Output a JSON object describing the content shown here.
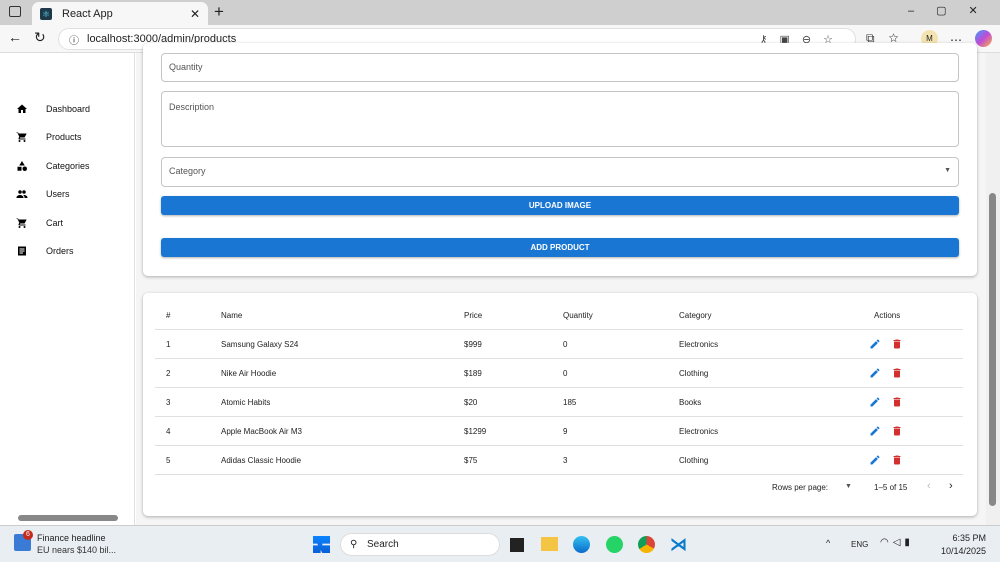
{
  "browser": {
    "tab_title": "React App",
    "url": "localhost:3000/admin/products",
    "profile": "M"
  },
  "sidebar": {
    "items": [
      {
        "label": "Dashboard",
        "icon": "home-icon"
      },
      {
        "label": "Products",
        "icon": "cart-icon"
      },
      {
        "label": "Categories",
        "icon": "category-icon"
      },
      {
        "label": "Users",
        "icon": "people-icon"
      },
      {
        "label": "Cart",
        "icon": "cart-icon"
      },
      {
        "label": "Orders",
        "icon": "list-icon"
      }
    ]
  },
  "form": {
    "quantity_label": "Quantity",
    "description_label": "Description",
    "category_label": "Category",
    "upload_label": "UPLOAD IMAGE",
    "add_label": "ADD PRODUCT"
  },
  "table": {
    "headers": [
      "#",
      "Name",
      "Price",
      "Quantity",
      "Category",
      "Actions"
    ],
    "rows": [
      [
        "1",
        "Samsung Galaxy S24",
        "$999",
        "0",
        "Electronics"
      ],
      [
        "2",
        "Nike Air Hoodie",
        "$189",
        "0",
        "Clothing"
      ],
      [
        "3",
        "Atomic Habits",
        "$20",
        "185",
        "Books"
      ],
      [
        "4",
        "Apple MacBook Air M3",
        "$1299",
        "9",
        "Electronics"
      ],
      [
        "5",
        "Adidas Classic Hoodie",
        "$75",
        "3",
        "Clothing"
      ]
    ],
    "rows_per_page_label": "Rows per page:",
    "range": "1–5 of 15"
  },
  "taskbar": {
    "news_title": "Finance headline",
    "news_sub": "EU nears $140 bil...",
    "badge": "6",
    "search": "Search",
    "lang": "ENG",
    "time": "6:35 PM",
    "date": "10/14/2025"
  },
  "colors": {
    "primary": "#1976d2",
    "delete": "#d32f2f"
  }
}
